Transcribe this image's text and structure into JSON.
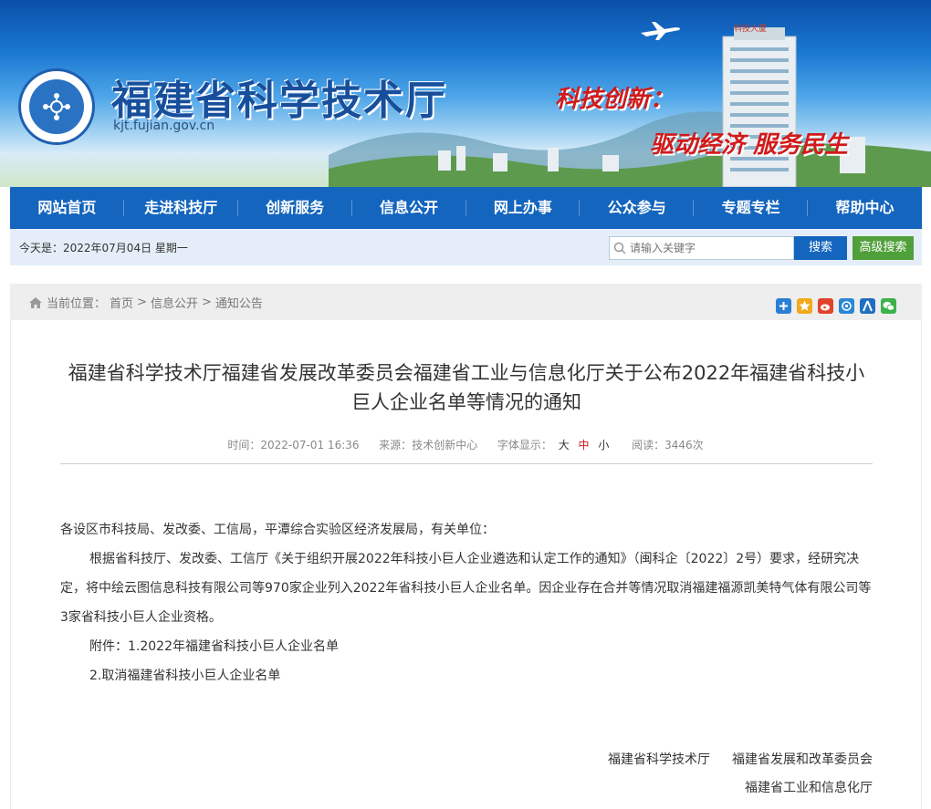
{
  "header": {
    "site_title": "福建省科学技术厅",
    "site_domain": "kjt.fujian.gov.cn",
    "slogan_1": "科技创新：",
    "slogan_2": "驱动经济 服务民生",
    "building_sign": "科技大厦"
  },
  "nav": {
    "items": [
      "网站首页",
      "走进科技厅",
      "创新服务",
      "信息公开",
      "网上办事",
      "公众参与",
      "专题专栏",
      "帮助中心"
    ]
  },
  "infobar": {
    "date_text": "今天是：2022年07月04日  星期一",
    "search_placeholder": "请输入关键字",
    "search_button": "搜索",
    "advanced_search_button": "高级搜索"
  },
  "breadcrumb": {
    "prefix": "当前位置：",
    "items": [
      "首页",
      "信息公开",
      "通知公告"
    ],
    "separator": ">"
  },
  "share_icons": [
    "plus-share-icon",
    "star-share-icon",
    "weibo-share-icon",
    "qzone-share-icon",
    "renren-share-icon",
    "wechat-share-icon"
  ],
  "colors": {
    "primary": "#1465be",
    "advanced": "#4f9f3a",
    "slogan": "#d21a1a"
  },
  "article": {
    "title": "福建省科学技术厅福建省发展改革委员会福建省工业与信息化厅关于公布2022年福建省科技小巨人企业名单等情况的通知",
    "meta": {
      "time_label": "时间：",
      "time_value": "2022-07-01 16:36",
      "source_label": "来源：",
      "source_value": "技术创新中心",
      "font_label": "字体显示：",
      "font_large": "大",
      "font_medium": "中",
      "font_small": "小",
      "views_label": "阅读：",
      "views_value": "3446次"
    },
    "salutation": "各设区市科技局、发改委、工信局，平潭综合实验区经济发展局，有关单位：",
    "paragraph": "根据省科技厅、发改委、工信厅《关于组织开展2022年科技小巨人企业遴选和认定工作的通知》（闽科企〔2022〕2号）要求，经研究决定，将中绘云图信息科技有限公司等970家企业列入2022年省科技小巨人企业名单。因企业存在合并等情况取消福建福源凯美特气体有限公司等3家省科技小巨人企业资格。",
    "attachment_1": "附件：1.2022年福建省科技小巨人企业名单",
    "attachment_2": "2.取消福建省科技小巨人企业名单",
    "signatories_line1_a": "福建省科学技术厅",
    "signatories_line1_b": "福建省发展和改革委员会",
    "signatories_line2": "福建省工业和信息化厅"
  }
}
